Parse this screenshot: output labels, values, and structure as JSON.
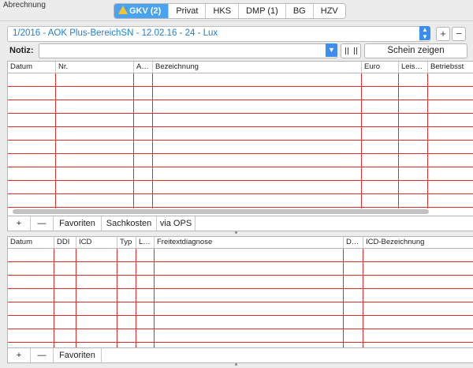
{
  "window": {
    "title": "Abrechnung"
  },
  "tabs": [
    {
      "label": "GKV (2)",
      "active": true,
      "warning": true
    },
    {
      "label": "Privat"
    },
    {
      "label": "HKS"
    },
    {
      "label": "DMP (1)"
    },
    {
      "label": "BG"
    },
    {
      "label": "HZV"
    }
  ],
  "case_selector": {
    "value": "1/2016 - AOK Plus-BereichSN -  12.02.16 - 24 - Lux"
  },
  "add_label": "+",
  "remove_label": "−",
  "notiz": {
    "label": "Notiz:",
    "value": ""
  },
  "schein_button": "Schein zeigen",
  "services_table": {
    "columns": [
      "Datum",
      "Nr.",
      "A…",
      "Bezeichnung",
      "Euro",
      "Leis…",
      "Betriebsst"
    ]
  },
  "services_toolbar": {
    "buttons": [
      "+",
      "—",
      "Favoriten",
      "Sachkosten",
      "via OPS"
    ]
  },
  "diagnosis_table": {
    "columns": [
      "Datum",
      "DDI",
      "ICD",
      "Typ",
      "L…",
      "Freitextdiagnose",
      "D…",
      "ICD-Bezeichnung"
    ]
  },
  "diagnosis_toolbar": {
    "buttons": [
      "+",
      "—",
      "Favoriten"
    ]
  },
  "colors": {
    "accent": "#3b8ef0",
    "active_tab": "#4aa3f0",
    "grid_line": "#e02b2b",
    "case_text": "#1c7fd6",
    "warning": "#f3c431"
  }
}
